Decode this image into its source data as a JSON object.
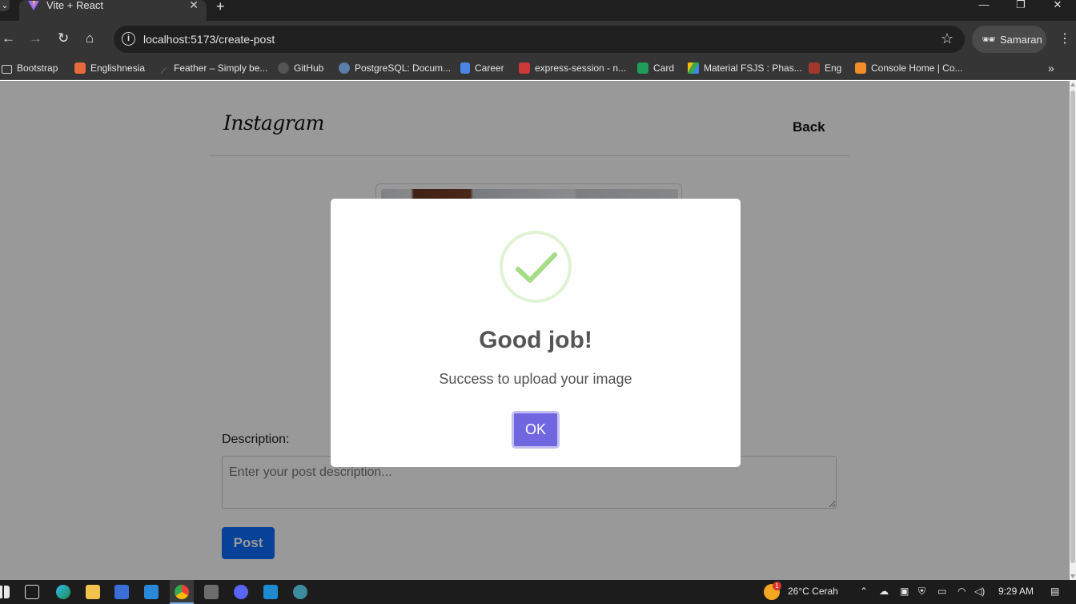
{
  "browser": {
    "tab_title": "Vite + React",
    "tab_close": "✕",
    "new_tab": "+",
    "url": "localhost:5173/create-post",
    "profile_name": "Samaran",
    "bookmarks": [
      {
        "label": "Bootstrap",
        "icon": "folder-icon"
      },
      {
        "label": "Englishnesia",
        "icon": "englishnesia-icon"
      },
      {
        "label": "Feather – Simply be...",
        "icon": "feather-icon"
      },
      {
        "label": "GitHub",
        "icon": "github-icon"
      },
      {
        "label": "PostgreSQL: Docum...",
        "icon": "postgresql-icon"
      },
      {
        "label": "Career",
        "icon": "docs-icon"
      },
      {
        "label": "express-session - n...",
        "icon": "npm-icon"
      },
      {
        "label": "Card",
        "icon": "sheets-icon"
      },
      {
        "label": "Material FSJS : Phas...",
        "icon": "drive-icon"
      },
      {
        "label": "Eng",
        "icon": "bookmark-icon"
      },
      {
        "label": "Console Home | Co...",
        "icon": "aws-icon"
      }
    ]
  },
  "page": {
    "logo": "Instagram",
    "back_label": "Back",
    "description_label": "Description:",
    "description_placeholder": "Enter your post description...",
    "post_label": "Post"
  },
  "modal": {
    "title": "Good job!",
    "text": "Success to upload your image",
    "ok_label": "OK",
    "icon": "success-check-icon",
    "button_color": "#7066e0"
  },
  "taskbar": {
    "weather_badge": "1",
    "weather": "26°C  Cerah",
    "time": "9:29 AM"
  }
}
